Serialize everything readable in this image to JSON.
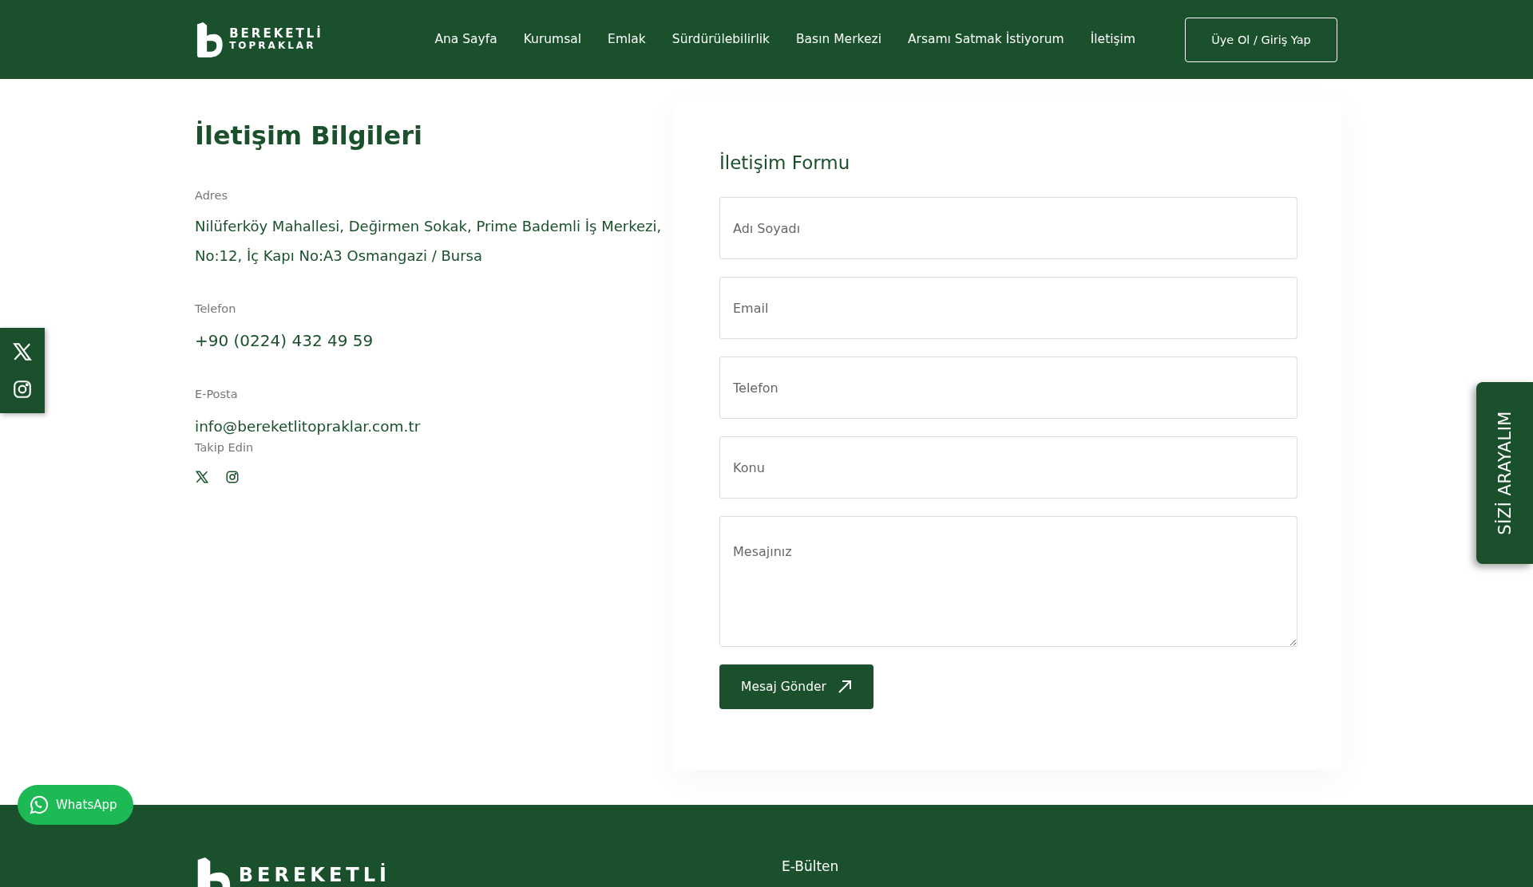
{
  "header": {
    "logo": {
      "line1": "BEREKETLİ",
      "line2": "TOPRAKLAR"
    },
    "nav": [
      {
        "label": "Ana Sayfa",
        "selected": false
      },
      {
        "label": "Kurumsal",
        "selected": false
      },
      {
        "label": "Emlak",
        "selected": false
      },
      {
        "label": "Sürdürülebilirlik",
        "selected": false
      },
      {
        "label": "Basın Merkezi",
        "selected": false
      },
      {
        "label": "Arsamı Satmak İstiyorum",
        "selected": false
      },
      {
        "label": "İletişim",
        "selected": false
      }
    ],
    "login_button": "Üye Ol / Giriş Yap"
  },
  "contact_info": {
    "title": "İletişim Bilgileri",
    "items": [
      {
        "label": "Adres",
        "value": "Nilüferköy Mahallesi, Değirmen Sokak, Prime Bademli İş Merkezi, No:12, İç Kapı No:A3 Osmangazi / Bursa"
      },
      {
        "label": "Telefon",
        "value": "+90 (0224) 432 49 59"
      },
      {
        "label": "E-Posta",
        "value": "info@bereketlitopraklar.com.tr"
      }
    ],
    "follow_label": "Takip Edin"
  },
  "contact_form": {
    "title": "İletişim Formu",
    "fields": [
      {
        "kind": "input",
        "placeholder": "Adı Soyadı"
      },
      {
        "kind": "input",
        "placeholder": "Email"
      },
      {
        "kind": "input",
        "placeholder": "Telefon"
      },
      {
        "kind": "input",
        "placeholder": "Konu"
      },
      {
        "kind": "textarea",
        "placeholder": "Mesajınız"
      }
    ],
    "submit": "Mesaj Gönder"
  },
  "callback_tab": "SİZİ ARAYALIM",
  "whatsapp": "WhatsApp",
  "footer": {
    "logo": "BEREKETLİ",
    "newsletter_title": "E-Bülten"
  }
}
